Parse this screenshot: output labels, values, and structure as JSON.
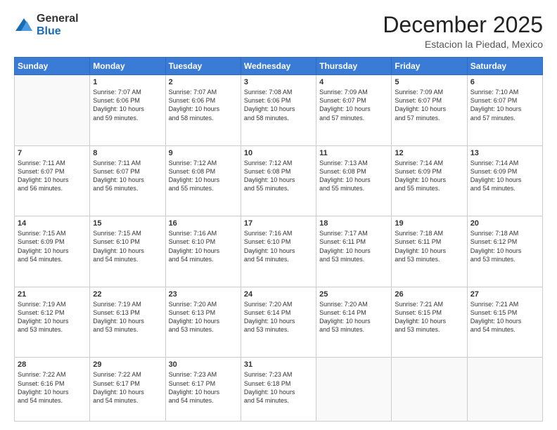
{
  "header": {
    "logo": {
      "general": "General",
      "blue": "Blue"
    },
    "title": "December 2025",
    "location": "Estacion la Piedad, Mexico"
  },
  "days_of_week": [
    "Sunday",
    "Monday",
    "Tuesday",
    "Wednesday",
    "Thursday",
    "Friday",
    "Saturday"
  ],
  "weeks": [
    [
      {
        "day": "",
        "info": ""
      },
      {
        "day": "1",
        "info": "Sunrise: 7:07 AM\nSunset: 6:06 PM\nDaylight: 10 hours\nand 59 minutes."
      },
      {
        "day": "2",
        "info": "Sunrise: 7:07 AM\nSunset: 6:06 PM\nDaylight: 10 hours\nand 58 minutes."
      },
      {
        "day": "3",
        "info": "Sunrise: 7:08 AM\nSunset: 6:06 PM\nDaylight: 10 hours\nand 58 minutes."
      },
      {
        "day": "4",
        "info": "Sunrise: 7:09 AM\nSunset: 6:07 PM\nDaylight: 10 hours\nand 57 minutes."
      },
      {
        "day": "5",
        "info": "Sunrise: 7:09 AM\nSunset: 6:07 PM\nDaylight: 10 hours\nand 57 minutes."
      },
      {
        "day": "6",
        "info": "Sunrise: 7:10 AM\nSunset: 6:07 PM\nDaylight: 10 hours\nand 57 minutes."
      }
    ],
    [
      {
        "day": "7",
        "info": "Sunrise: 7:11 AM\nSunset: 6:07 PM\nDaylight: 10 hours\nand 56 minutes."
      },
      {
        "day": "8",
        "info": "Sunrise: 7:11 AM\nSunset: 6:07 PM\nDaylight: 10 hours\nand 56 minutes."
      },
      {
        "day": "9",
        "info": "Sunrise: 7:12 AM\nSunset: 6:08 PM\nDaylight: 10 hours\nand 55 minutes."
      },
      {
        "day": "10",
        "info": "Sunrise: 7:12 AM\nSunset: 6:08 PM\nDaylight: 10 hours\nand 55 minutes."
      },
      {
        "day": "11",
        "info": "Sunrise: 7:13 AM\nSunset: 6:08 PM\nDaylight: 10 hours\nand 55 minutes."
      },
      {
        "day": "12",
        "info": "Sunrise: 7:14 AM\nSunset: 6:09 PM\nDaylight: 10 hours\nand 55 minutes."
      },
      {
        "day": "13",
        "info": "Sunrise: 7:14 AM\nSunset: 6:09 PM\nDaylight: 10 hours\nand 54 minutes."
      }
    ],
    [
      {
        "day": "14",
        "info": "Sunrise: 7:15 AM\nSunset: 6:09 PM\nDaylight: 10 hours\nand 54 minutes."
      },
      {
        "day": "15",
        "info": "Sunrise: 7:15 AM\nSunset: 6:10 PM\nDaylight: 10 hours\nand 54 minutes."
      },
      {
        "day": "16",
        "info": "Sunrise: 7:16 AM\nSunset: 6:10 PM\nDaylight: 10 hours\nand 54 minutes."
      },
      {
        "day": "17",
        "info": "Sunrise: 7:16 AM\nSunset: 6:10 PM\nDaylight: 10 hours\nand 54 minutes."
      },
      {
        "day": "18",
        "info": "Sunrise: 7:17 AM\nSunset: 6:11 PM\nDaylight: 10 hours\nand 53 minutes."
      },
      {
        "day": "19",
        "info": "Sunrise: 7:18 AM\nSunset: 6:11 PM\nDaylight: 10 hours\nand 53 minutes."
      },
      {
        "day": "20",
        "info": "Sunrise: 7:18 AM\nSunset: 6:12 PM\nDaylight: 10 hours\nand 53 minutes."
      }
    ],
    [
      {
        "day": "21",
        "info": "Sunrise: 7:19 AM\nSunset: 6:12 PM\nDaylight: 10 hours\nand 53 minutes."
      },
      {
        "day": "22",
        "info": "Sunrise: 7:19 AM\nSunset: 6:13 PM\nDaylight: 10 hours\nand 53 minutes."
      },
      {
        "day": "23",
        "info": "Sunrise: 7:20 AM\nSunset: 6:13 PM\nDaylight: 10 hours\nand 53 minutes."
      },
      {
        "day": "24",
        "info": "Sunrise: 7:20 AM\nSunset: 6:14 PM\nDaylight: 10 hours\nand 53 minutes."
      },
      {
        "day": "25",
        "info": "Sunrise: 7:20 AM\nSunset: 6:14 PM\nDaylight: 10 hours\nand 53 minutes."
      },
      {
        "day": "26",
        "info": "Sunrise: 7:21 AM\nSunset: 6:15 PM\nDaylight: 10 hours\nand 53 minutes."
      },
      {
        "day": "27",
        "info": "Sunrise: 7:21 AM\nSunset: 6:15 PM\nDaylight: 10 hours\nand 54 minutes."
      }
    ],
    [
      {
        "day": "28",
        "info": "Sunrise: 7:22 AM\nSunset: 6:16 PM\nDaylight: 10 hours\nand 54 minutes."
      },
      {
        "day": "29",
        "info": "Sunrise: 7:22 AM\nSunset: 6:17 PM\nDaylight: 10 hours\nand 54 minutes."
      },
      {
        "day": "30",
        "info": "Sunrise: 7:23 AM\nSunset: 6:17 PM\nDaylight: 10 hours\nand 54 minutes."
      },
      {
        "day": "31",
        "info": "Sunrise: 7:23 AM\nSunset: 6:18 PM\nDaylight: 10 hours\nand 54 minutes."
      },
      {
        "day": "",
        "info": ""
      },
      {
        "day": "",
        "info": ""
      },
      {
        "day": "",
        "info": ""
      }
    ]
  ]
}
